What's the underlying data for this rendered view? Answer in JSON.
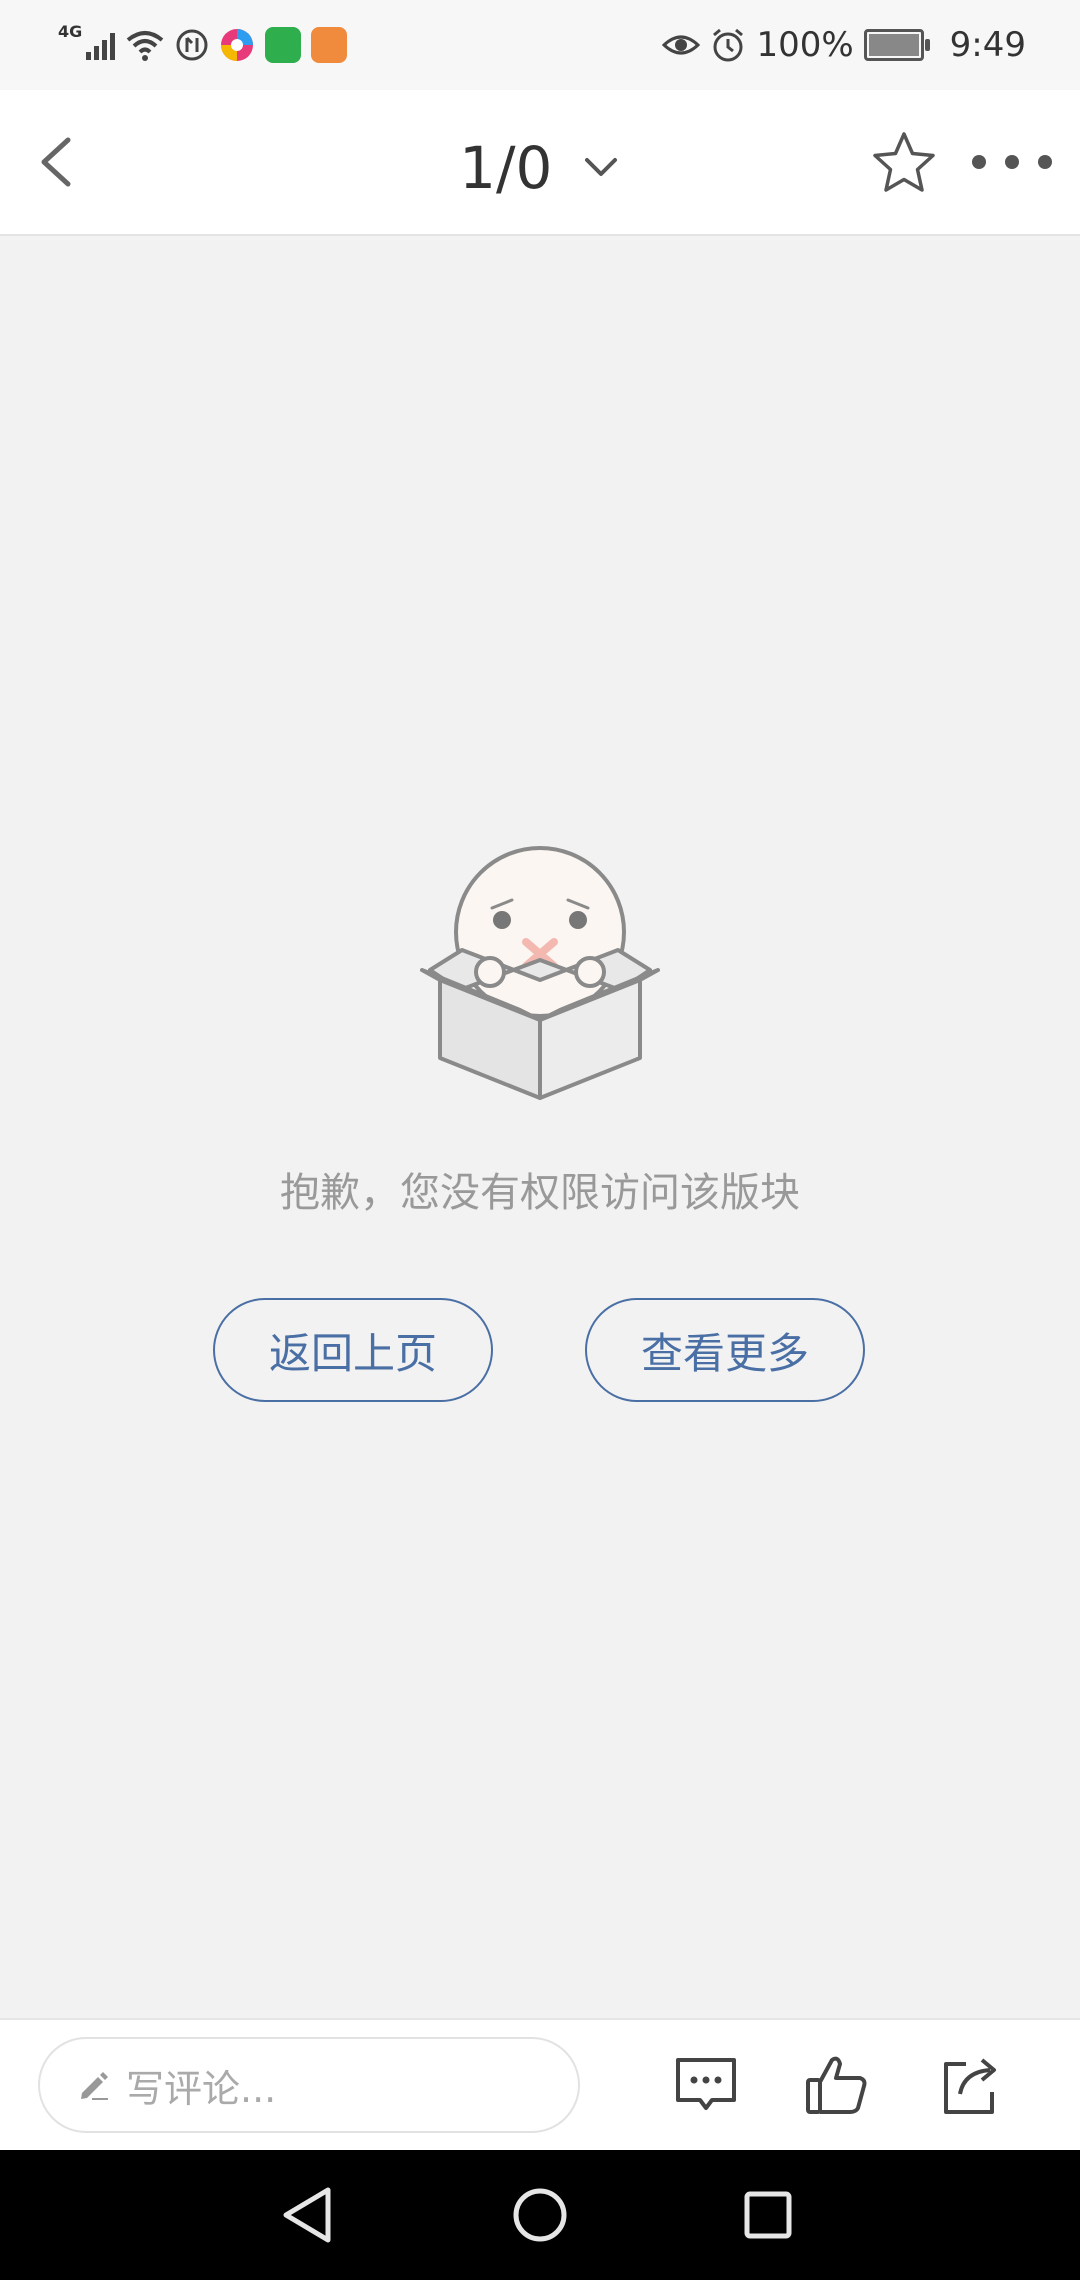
{
  "status_bar": {
    "network": "4G",
    "battery": "100%",
    "time": "9:49"
  },
  "header": {
    "title": "1/0"
  },
  "empty_state": {
    "message": "抱歉，您没有权限访问该版块",
    "back_button": "返回上页",
    "more_button": "查看更多"
  },
  "comment_bar": {
    "placeholder": "写评论..."
  },
  "colors": {
    "accent": "#4a6fa5",
    "background": "#f2f2f2",
    "muted_text": "#999999"
  }
}
